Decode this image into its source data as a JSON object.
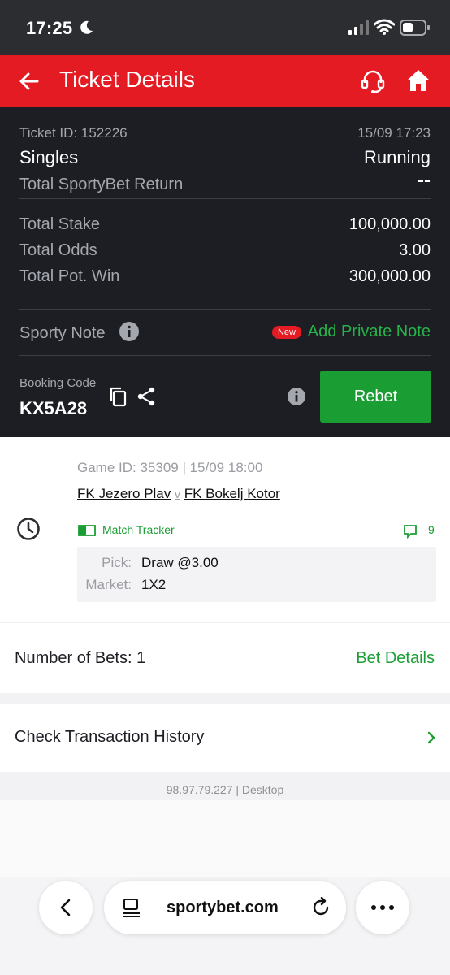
{
  "status_bar": {
    "time": "17:25"
  },
  "header": {
    "title": "Ticket Details"
  },
  "ticket": {
    "id_label": "Ticket ID: 152226",
    "datetime": "15/09 17:23",
    "bet_type": "Singles",
    "status": "Running",
    "return_label": "Total SportyBet Return",
    "return_value": "--",
    "stake_label": "Total Stake",
    "stake_value": "100,000.00",
    "odds_label": "Total Odds",
    "odds_value": "3.00",
    "potwin_label": "Total Pot. Win",
    "potwin_value": "300,000.00",
    "note_label": "Sporty Note",
    "new_badge": "New",
    "add_note": "Add Private Note",
    "booking_label": "Booking Code",
    "booking_code": "KX5A28",
    "rebet": "Rebet"
  },
  "game": {
    "meta": "Game ID: 35309 | 15/09 18:00",
    "home": "FK Jezero Plav",
    "vs": "v",
    "away": "FK Bokelj Kotor",
    "tracker": "Match Tracker",
    "comments": "9",
    "pick_label": "Pick:",
    "pick_value": "Draw @3.00",
    "market_label": "Market:",
    "market_value": "1X2"
  },
  "bets": {
    "label": "Number of Bets: 1",
    "details": "Bet Details"
  },
  "transactions": {
    "label": "Check Transaction History"
  },
  "footer_ip": "98.97.79.227 | Desktop",
  "browser": {
    "url": "sportybet.com"
  },
  "colors": {
    "brand_red": "#e41b23",
    "accent_green": "#1a9e34",
    "dark_bg": "#1c1e24"
  }
}
